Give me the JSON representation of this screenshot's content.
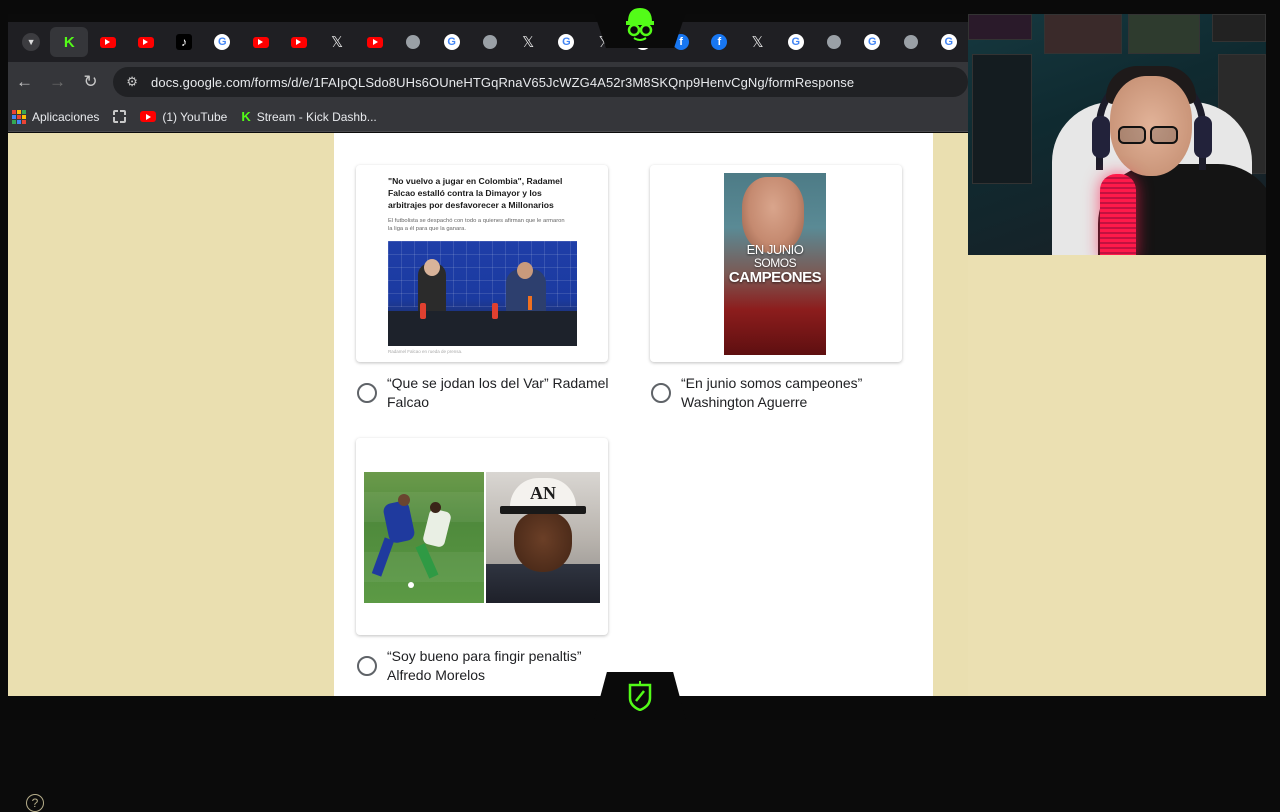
{
  "browser": {
    "tabs": [
      {
        "icon": "chevron-down-icon",
        "type": "dd",
        "glyph": "▼"
      },
      {
        "icon": "kick-icon",
        "type": "k",
        "glyph": "K"
      },
      {
        "icon": "youtube-icon",
        "type": "yt",
        "glyph": ""
      },
      {
        "icon": "youtube-icon",
        "type": "yt",
        "glyph": ""
      },
      {
        "icon": "tiktok-icon",
        "type": "tt",
        "glyph": "♪"
      },
      {
        "icon": "google-icon",
        "type": "g",
        "glyph": "G"
      },
      {
        "icon": "youtube-icon",
        "type": "yt",
        "glyph": ""
      },
      {
        "icon": "youtube-icon",
        "type": "yt",
        "glyph": ""
      },
      {
        "icon": "x-icon",
        "type": "x",
        "glyph": "𝕏"
      },
      {
        "icon": "youtube-icon",
        "type": "yt",
        "glyph": ""
      },
      {
        "icon": "chrome-icon",
        "type": "globe",
        "glyph": ""
      },
      {
        "icon": "google-icon",
        "type": "g",
        "glyph": "G"
      },
      {
        "icon": "globe-icon",
        "type": "globe",
        "glyph": ""
      },
      {
        "icon": "x-icon",
        "type": "x",
        "glyph": "𝕏"
      },
      {
        "icon": "google-icon",
        "type": "g",
        "glyph": "G"
      },
      {
        "icon": "x-icon",
        "type": "x",
        "glyph": "𝕏"
      },
      {
        "icon": "google-icon",
        "type": "g",
        "glyph": "G"
      },
      {
        "icon": "facebook-icon",
        "type": "fb",
        "glyph": "f"
      },
      {
        "icon": "facebook-icon",
        "type": "fb",
        "glyph": "f"
      },
      {
        "icon": "x-icon",
        "type": "x",
        "glyph": "𝕏"
      },
      {
        "icon": "google-icon",
        "type": "g",
        "glyph": "G"
      },
      {
        "icon": "globe-icon",
        "type": "globe",
        "glyph": ""
      },
      {
        "icon": "google-icon",
        "type": "g",
        "glyph": "G"
      },
      {
        "icon": "globe-icon",
        "type": "globe",
        "glyph": ""
      },
      {
        "icon": "google-icon",
        "type": "g",
        "glyph": "G"
      }
    ],
    "nav": {
      "back": "←",
      "forward": "→",
      "reload": "↻",
      "site_info": "⚙"
    },
    "url": "docs.google.com/forms/d/e/1FAIpQLSdo8UHs6OUneHTGqRnaV65JcWZG4A52r3M8SKQnp9HenvCgNg/formResponse",
    "bookmarks": [
      {
        "label": "Aplicaciones",
        "icon": "apps-grid-icon"
      },
      {
        "label": "",
        "icon": "grid-icon"
      },
      {
        "label": "(1) YouTube",
        "icon": "youtube-icon"
      },
      {
        "label": "Stream - Kick Dashb...",
        "icon": "kick-icon"
      }
    ]
  },
  "form": {
    "options": [
      {
        "label": "“Que se jodan los del Var” Radamel Falcao",
        "image": {
          "headline": "\"No vuelvo a jugar en Colombia\", Radamel Falcao estalló contra la Dimayor y los arbitrajes por desfavorecer a Millonarios",
          "subtext": "El futbolista se despachó con todo a quienes afirman que le armaron la liga a él para que la ganara.",
          "caption": "Radamel Falcao en rueda de prensa."
        }
      },
      {
        "label": "“En junio somos campeones” Washington Aguerre",
        "image": {
          "line1": "EN JUNIO",
          "line2": "SOMOS",
          "line3": "CAMPEONES"
        }
      },
      {
        "label": "“Soy bueno para fingir penaltis” Alfredo Morelos",
        "image": {
          "cap_text": "AN"
        }
      }
    ],
    "help_glyph": "?"
  },
  "colors": {
    "page_background": "#eadfb0",
    "card_background": "#ffffff",
    "browser_chrome": "#35363a",
    "tab_strip": "#1f1f23",
    "kick_green": "#53fc18"
  }
}
